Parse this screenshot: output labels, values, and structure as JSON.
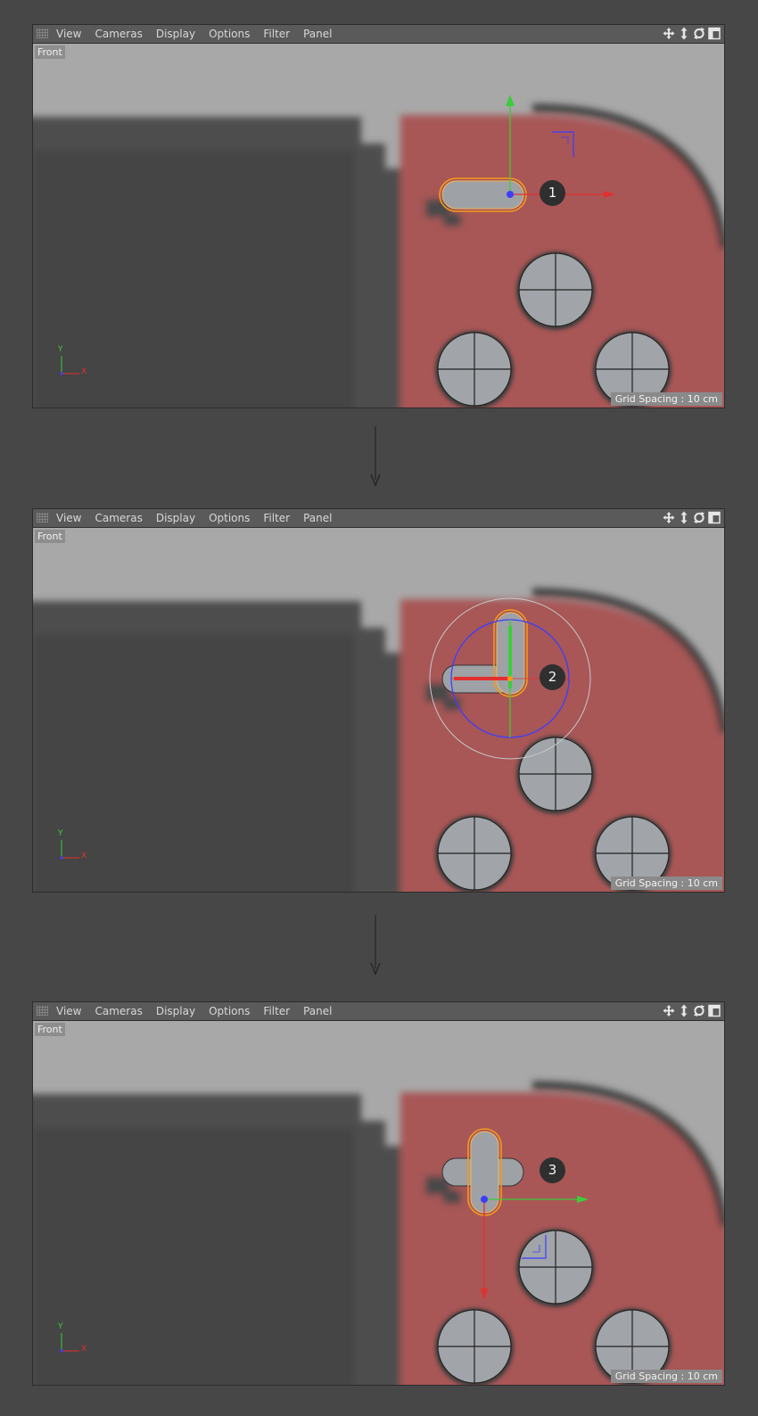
{
  "menu": [
    "View",
    "Cameras",
    "Display",
    "Options",
    "Filter",
    "Panel"
  ],
  "nav_icons": [
    "move-icon",
    "zoom-icon",
    "rotate-icon",
    "maximize-icon"
  ],
  "viewports": [
    {
      "camera": "Front",
      "grid_spacing": "Grid Spacing : 10 cm",
      "step": "1"
    },
    {
      "camera": "Front",
      "grid_spacing": "Grid Spacing : 10 cm",
      "step": "2"
    },
    {
      "camera": "Front",
      "grid_spacing": "Grid Spacing : 10 cm",
      "step": "3"
    }
  ],
  "axes": {
    "y": "Y",
    "x": "X"
  },
  "colors": {
    "background": "#474747",
    "viewport_sky": "#a8a8a8",
    "console_red": "#a85656",
    "selection_orange": "#f39a1e",
    "axis_x": "#e23030",
    "axis_y": "#3ccc3c",
    "axis_z": "#3d3dff"
  }
}
